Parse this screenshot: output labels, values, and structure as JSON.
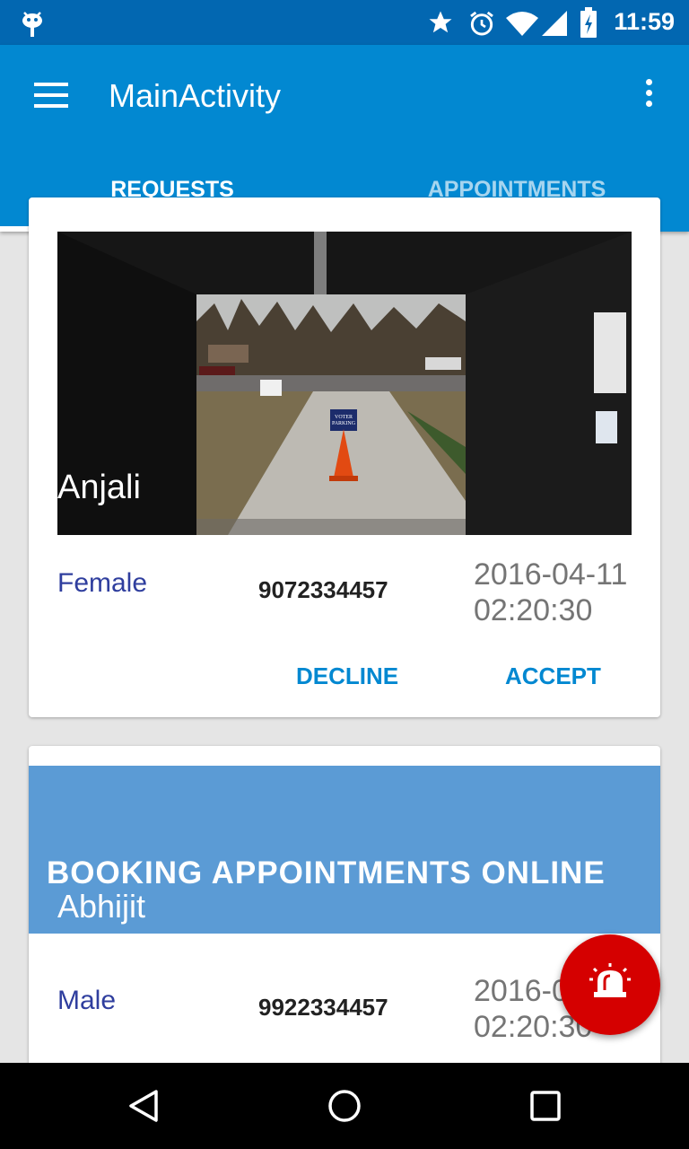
{
  "status_bar": {
    "time": "11:59"
  },
  "app_bar": {
    "title": "MainActivity"
  },
  "tabs": [
    {
      "label": "REQUESTS",
      "selected": true
    },
    {
      "label": "APPOINTMENTS",
      "selected": false
    }
  ],
  "requests": [
    {
      "name": "Anjali",
      "gender": "Female",
      "phone": "9072334457",
      "date": "2016-04-11",
      "time": "02:20:30",
      "decline_label": "DECLINE",
      "accept_label": "ACCEPT"
    },
    {
      "banner_text": "BOOKING APPOINTMENTS ONLINE",
      "name": "Abhijit",
      "gender": "Male",
      "phone": "9922334457",
      "date": "2016-04-11",
      "time": "02:20:30"
    }
  ],
  "photo_sign_text": [
    "VOTER",
    "PARKING"
  ],
  "colors": {
    "primary": "#0288d1",
    "status_bar": "#0267b1",
    "accent_fab": "#d50000",
    "gender_text": "#2f3e9e",
    "banner": "#5b9bd5"
  },
  "icons": {
    "status_bar": [
      "android-debug-icon",
      "star-icon",
      "alarm-icon",
      "wifi-icon",
      "cell-signal-icon",
      "battery-charging-icon"
    ],
    "app_bar": [
      "menu-icon",
      "more-vert-icon"
    ],
    "fab": "siren-alarm-icon",
    "nav": [
      "back-icon",
      "home-icon",
      "recents-icon"
    ]
  }
}
